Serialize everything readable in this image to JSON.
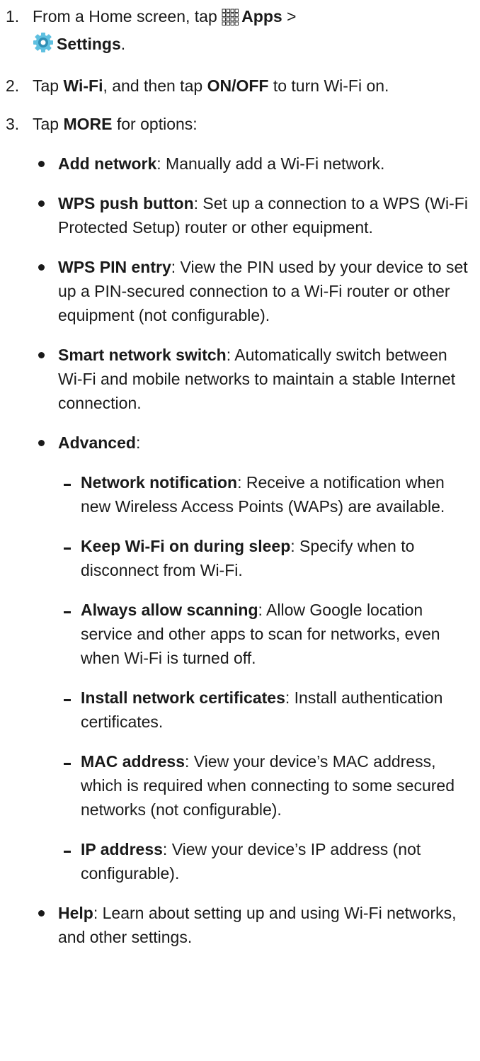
{
  "steps": [
    {
      "number": "1.",
      "pre": "From a Home screen, tap ",
      "apps_label": "Apps",
      "sep": " >",
      "settings_label": "Settings",
      "post": "."
    },
    {
      "number": "2.",
      "t1": "Tap ",
      "b1": "Wi-Fi",
      "t2": ", and then tap ",
      "b2": "ON/OFF",
      "t3": " to turn Wi-Fi on."
    },
    {
      "number": "3.",
      "t1": "Tap ",
      "b1": "MORE",
      "t2": " for options:"
    }
  ],
  "options": [
    {
      "term": "Add network",
      "desc": ": Manually add a Wi-Fi network."
    },
    {
      "term": "WPS push button",
      "desc": ": Set up a connection to a WPS (Wi-Fi Protected Setup) router or other equipment."
    },
    {
      "term": "WPS PIN entry",
      "desc": ": View the PIN used by your device to set up a PIN-secured connection to a Wi-Fi router or other equipment (not configurable)."
    },
    {
      "term": "Smart network switch",
      "desc": ": Automatically switch between Wi-Fi and mobile networks to maintain a stable Internet connection."
    },
    {
      "term": "Advanced",
      "desc": ":"
    }
  ],
  "advanced": [
    {
      "term": "Network notification",
      "desc": ": Receive a notification when new Wireless Access Points (WAPs) are available."
    },
    {
      "term": "Keep Wi-Fi on during sleep",
      "desc": ": Specify when to disconnect from Wi-Fi."
    },
    {
      "term": "Always allow scanning",
      "desc": ": Allow Google location service and other apps to scan for networks, even when Wi-Fi is turned off."
    },
    {
      "term": "Install network certificates",
      "desc": ": Install authentication certificates."
    },
    {
      "term": "MAC address",
      "desc": ": View your device’s MAC address, which is required when connecting to some secured networks (not configurable)."
    },
    {
      "term": "IP address",
      "desc": ": View your device’s IP address (not configurable)."
    }
  ],
  "help": {
    "term": "Help",
    "desc": ": Learn about setting up and using Wi-Fi networks, and other settings."
  },
  "icons": {
    "apps": "apps-grid-icon",
    "settings": "settings-gear-icon"
  },
  "colors": {
    "text": "#1a1a1a",
    "settings_icon_teal": "#3aa6c9"
  }
}
